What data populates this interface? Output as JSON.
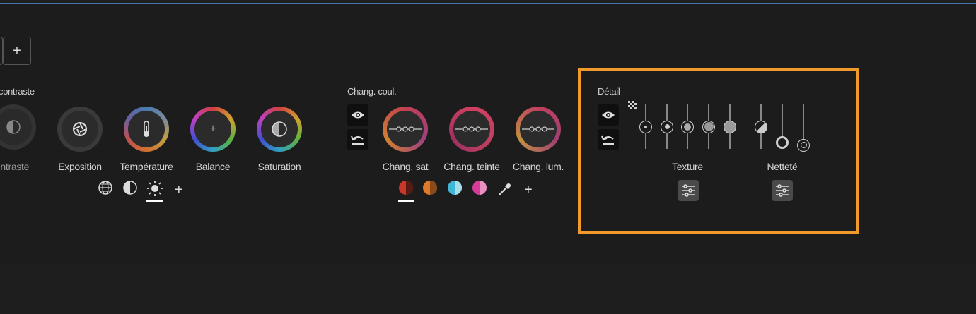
{
  "toolbar": {
    "add_label": "+"
  },
  "tone": {
    "title": "contraste",
    "dials": [
      {
        "label": "ontraste"
      },
      {
        "label": "Exposition"
      },
      {
        "label": "Température"
      },
      {
        "label": "Balance"
      },
      {
        "label": "Saturation"
      }
    ],
    "add_label": "+"
  },
  "color": {
    "title": "Chang. coul.",
    "dials": [
      {
        "label": "Chang. sat"
      },
      {
        "label": "Chang. teinte"
      },
      {
        "label": "Chang. lum."
      }
    ],
    "add_label": "+",
    "swatches": [
      "#c8382a",
      "#e07a2a",
      "#3fb5d8",
      "#d83c9a"
    ]
  },
  "detail": {
    "title": "Détail",
    "texture_label": "Texture",
    "sharpen_label": "Netteté"
  },
  "colors": {
    "accent": "#f09a2c",
    "panel": "#1c1c1c",
    "border": "#4a6fb0"
  }
}
